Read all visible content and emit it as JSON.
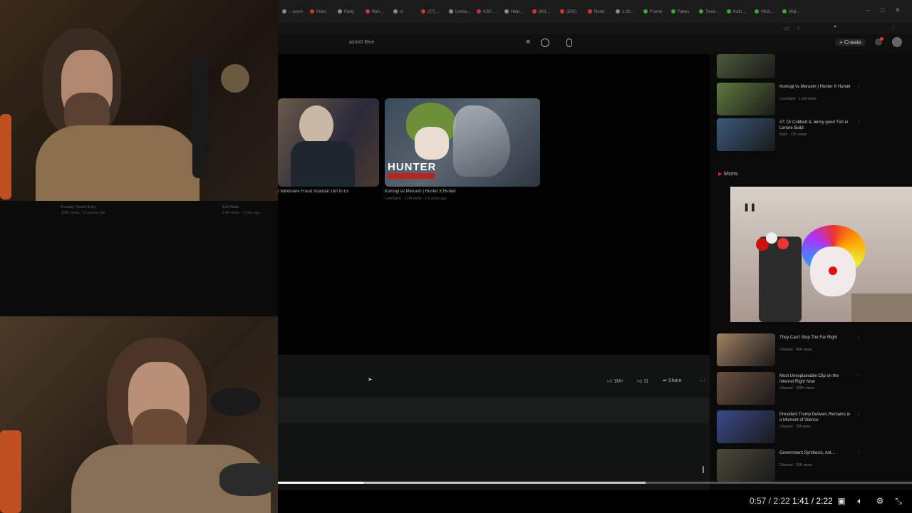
{
  "browser": {
    "tabs": [
      "…wson",
      "Picks",
      "Party",
      "Ran…",
      "rs",
      "(27)…",
      "Unrea…",
      "4:50 …",
      "Hide…",
      "(80)…",
      "(505)",
      "Rend",
      "1:30…",
      "Frame",
      "Fakes",
      "Twee…",
      "Kath…",
      "Mich…",
      "Wat…"
    ]
  },
  "youtube": {
    "search_query": "asmr0 Rise",
    "create_label": "Create",
    "shorts_label": "Shorts"
  },
  "grid_videos": [
    {
      "title": "r Millionaire Fraud Scandal: Dirt to Ex",
      "meta": ""
    },
    {
      "title": "Komugi vs Meruem | Hunter X Hunter",
      "meta": "LoneSpirit · 1.1M views · 1.5 years ago",
      "overlay": "HUNTER"
    }
  ],
  "faint_meta": [
    {
      "title": "Fantasy Trend's Entry",
      "meta": "1000 views · 11 months ago"
    },
    {
      "title": "Evil Media",
      "meta": "2.4K views · 1 hour ago"
    }
  ],
  "actions": {
    "like": "1M+",
    "dislike": "11",
    "share": "Share"
  },
  "sidebar_videos": [
    {
      "title": "",
      "meta": "",
      "color": "#4a5a3a"
    },
    {
      "title": "Komugi vs Meruem | Hunter X Hunter",
      "meta": "LoneSpirit · 1.1M views",
      "color": "#5f7a3d"
    },
    {
      "title": "#7: Dr Cobbert & Jenny good TVA in Lenore Build",
      "meta": "Build · 12K views",
      "color": "#3a5a7a"
    },
    {
      "title": "They Can't Stop The Far Right",
      "meta": "Channel · 80K views",
      "color": "#a08060"
    },
    {
      "title": "Most Unexplainable Clip on the Internet Right Now",
      "meta": "Channel · 400K views",
      "color": "#6a5040"
    },
    {
      "title": "President Trump Delivers Remarks in a Moment of Silence",
      "meta": "Channel · 2M views",
      "color": "#3a4a8a"
    },
    {
      "title": "Government Synthesis, Ant…",
      "meta": "Channel · 50K views",
      "color": "#4a4a3a"
    }
  ],
  "player": {
    "time_current": "0:57",
    "time_total": "2:22",
    "time_overlay": "1:41 / 2:22",
    "progress": 0.135,
    "buffered": 0.58
  },
  "colors": {
    "accent_red": "#ff0000",
    "youtube_bg": "#0f0f0f"
  }
}
